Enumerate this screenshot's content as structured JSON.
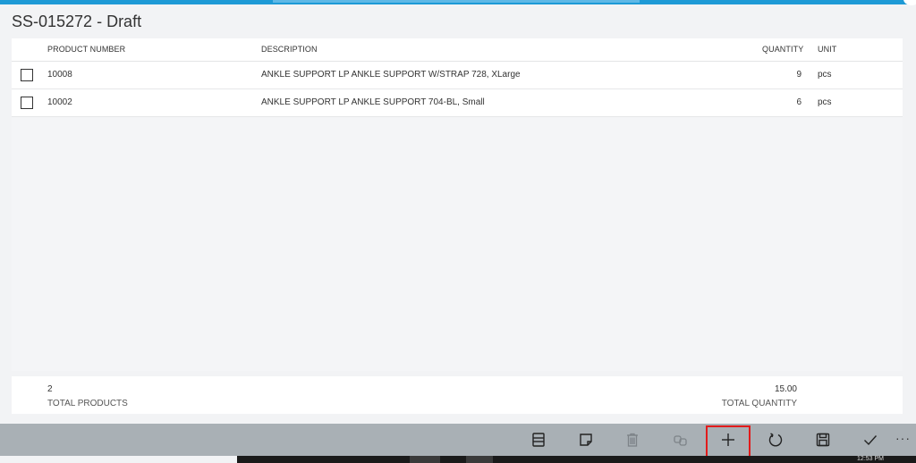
{
  "document": {
    "title": "SS-015272 - Draft"
  },
  "columns": {
    "product_number": "PRODUCT NUMBER",
    "description": "DESCRIPTION",
    "quantity": "QUANTITY",
    "unit": "UNIT"
  },
  "rows": [
    {
      "product_number": "10008",
      "description": "ANKLE SUPPORT LP ANKLE SUPPORT W/STRAP 728, XLarge",
      "quantity": "9",
      "unit": "pcs"
    },
    {
      "product_number": "10002",
      "description": "ANKLE SUPPORT LP ANKLE SUPPORT 704-BL, Small",
      "quantity": "6",
      "unit": "pcs"
    }
  ],
  "totals": {
    "products_value": "2",
    "products_label": "TOTAL PRODUCTS",
    "quantity_value": "15.00",
    "quantity_label": "TOTAL QUANTITY"
  },
  "commands": {
    "more": "···",
    "icons": [
      "list-view-icon",
      "note-icon",
      "delete-icon",
      "copy-icon",
      "add-icon",
      "refresh-icon",
      "save-icon",
      "confirm-icon"
    ]
  },
  "taskbar": {
    "clock": "12:53 PM"
  },
  "colors": {
    "accent": "#1e9ad6",
    "highlight": "#e21b1b",
    "command_bar": "#a9b0b5"
  }
}
